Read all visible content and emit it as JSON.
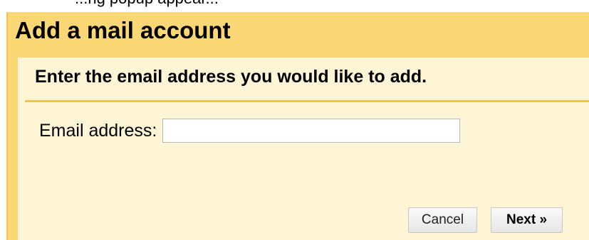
{
  "top_fragment": "...ng popup appear...",
  "dialog": {
    "title": "Add a mail account",
    "instruction": "Enter the email address you would like to add.",
    "email_label": "Email address:",
    "email_value": "",
    "email_placeholder": "",
    "cancel_label": "Cancel",
    "next_label": "Next »"
  },
  "colors": {
    "header_bg": "#fbd776",
    "body_bg": "#fef4d6",
    "divider": "#f2c548"
  }
}
